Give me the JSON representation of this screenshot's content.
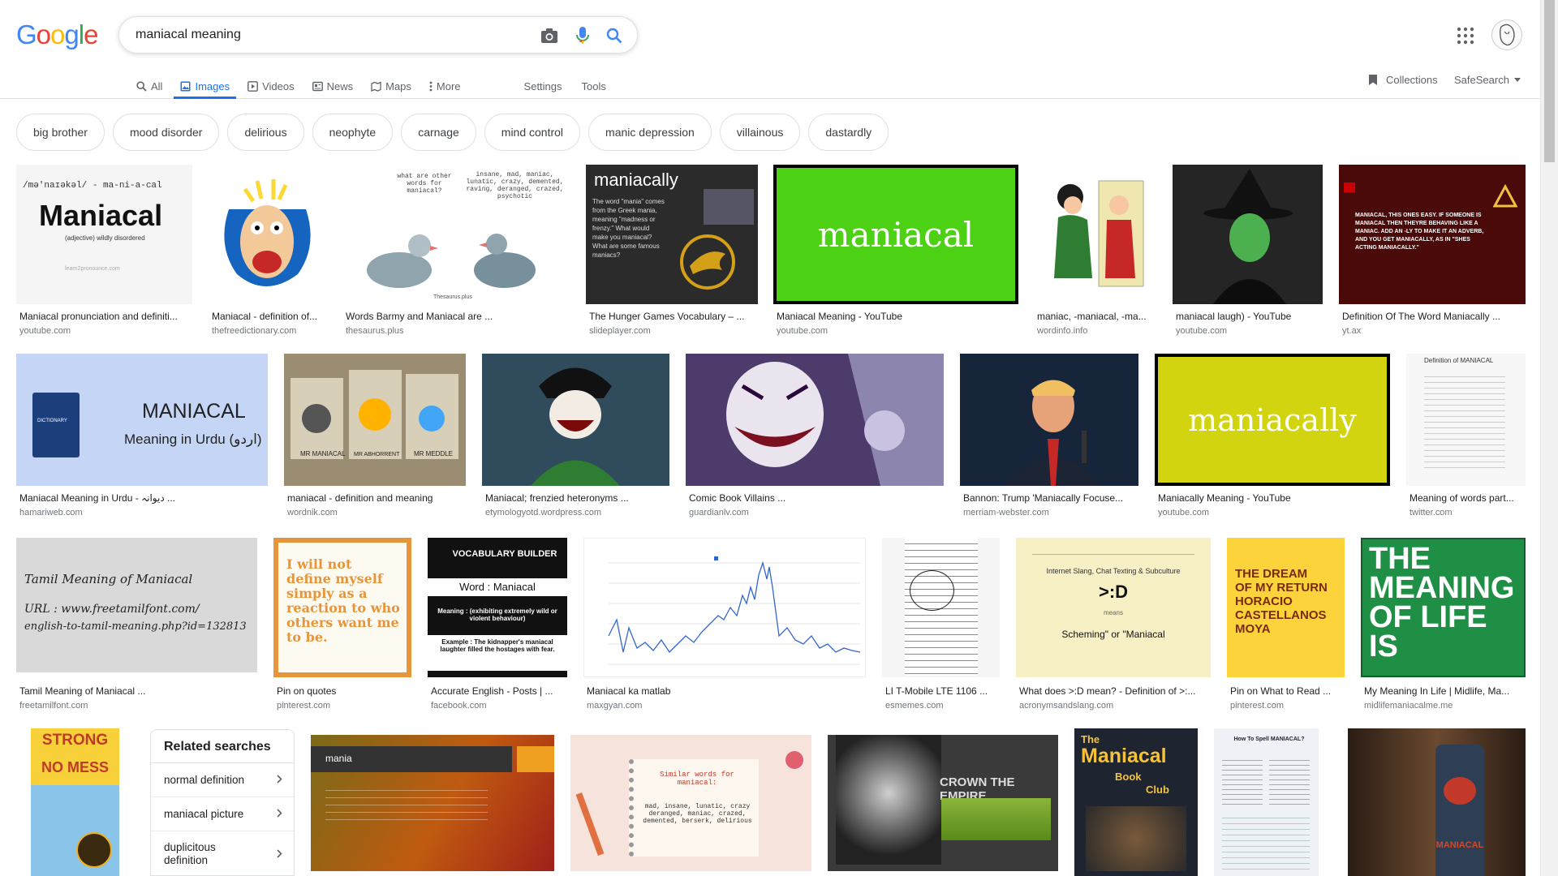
{
  "logo": {
    "letters": [
      "G",
      "o",
      "o",
      "g",
      "l",
      "e"
    ],
    "colors": [
      "#4285f4",
      "#ea4335",
      "#fbbc05",
      "#4285f4",
      "#34a853",
      "#ea4335"
    ]
  },
  "search": {
    "query": "maniacal meaning",
    "icons": [
      "camera-icon",
      "mic-icon",
      "search-icon"
    ]
  },
  "tabs": [
    {
      "label": "All",
      "icon": "search-icon"
    },
    {
      "label": "Images",
      "icon": "image-icon",
      "active": true
    },
    {
      "label": "Videos",
      "icon": "play-icon"
    },
    {
      "label": "News",
      "icon": "news-icon"
    },
    {
      "label": "Maps",
      "icon": "map-icon"
    },
    {
      "label": "More",
      "icon": "more-dots-icon"
    }
  ],
  "tools": {
    "settings": "Settings",
    "tools": "Tools",
    "collections": "Collections",
    "safesearch": "SafeSearch"
  },
  "chips": [
    "big brother",
    "mood disorder",
    "delirious",
    "neophyte",
    "carnage",
    "mind control",
    "manic depression",
    "villainous",
    "dastardly"
  ],
  "thumb_text": {
    "pronounce_phon": "/mə'naɪəkəl/ - ma-ni-a-cal",
    "pronounce_word": "Maniacal",
    "pronounce_def": "(adjective) wildly disordered",
    "pronounce_site": "learn2pronounce.com",
    "barmy_left": "what are other words for maniacal?",
    "barmy_right": "insane, mad, maniac, lunatic, crazy, demented, raving, deranged, crazed, psychotic",
    "barmy_src": "Thesaurus.plus",
    "hunger_title": "maniacally",
    "hunger_body": "The word \"mania\" comes from the Greek mania, meaning \"madness or frenzy.\" What would make you maniacal? What are some famous maniacs?",
    "yt_green": "maniacal",
    "wicked_text": "MANIACAL, THIS ONES EASY. IF SOMEONE IS MANIACAL THEN THEYRE BEHAVING LIKE A MANIAC. ADD AN -LY TO MAKE IT AN ADVERB, AND YOU GET MANIACALLY, AS IN \"SHES ACTING MANIACALLY.\"",
    "urdu_word": "MANIACAL",
    "urdu_sub": "Meaning in Urdu (اردو)",
    "dict_label": "DICTIONARY",
    "wordnik_labels": [
      "MR MANIACAL",
      "MR ABHORRENT",
      "MR MEDDLE"
    ],
    "yt_yellow": "maniacally",
    "twitter_title": "Definition of MANIACAL",
    "tamil_l1": "Tamil Meaning of Maniacal",
    "tamil_l2": "URL : www.freetamilfont.com/",
    "tamil_l3": "english-to-tamil-meaning.php?id=132813",
    "quote": "I will not define myself simply as a reaction to who others want me to be.",
    "vocab_head": "VOCABULARY BUILDER",
    "vocab_word": "Word : Maniacal",
    "vocab_meaning": "Meaning : (exhibiting extremely wild or violent behaviour)",
    "vocab_example": "Example : The kidnapper's maniacal laughter filled the hostages with fear.",
    "acro_head": "Internet Slang, Chat Texting & Subculture",
    "acro_big": ">:D",
    "acro_means": "means",
    "acro_def": "Scheming\" or \"Maniacal",
    "dream": [
      "THE DREAM",
      "OF MY RETURN",
      "HORACIO",
      "CASTELLANOS",
      "MOYA"
    ],
    "life": [
      "THE",
      "MEANING",
      "OF LIFE",
      "IS"
    ],
    "strong": [
      "STRONG",
      "NO MESS"
    ],
    "mania_title": "mania",
    "similar_title": "Similar words for maniacal:",
    "similar_body": "mad, insane, lunatic, crazy deranged, maniac, crazed, demented, berserk, delirious",
    "crown": "CROWN THE EMPIRE",
    "book": [
      "The",
      "Maniacal",
      "Book",
      "Club"
    ],
    "spell": "How To Spell MANIACAL?",
    "can": "MANIACAL"
  },
  "rows": [
    [
      {
        "title": "Maniacal pronunciation and definiti...",
        "src": "youtube.com"
      },
      {
        "title": "Maniacal - definition of...",
        "src": "thefreedictionary.com"
      },
      {
        "title": "Words Barmy and Maniacal are ...",
        "src": "thesaurus.plus"
      },
      {
        "title": "The Hunger Games Vocabulary – ...",
        "src": "slideplayer.com"
      },
      {
        "title": "Maniacal Meaning - YouTube",
        "src": "youtube.com"
      },
      {
        "title": "maniac, -maniacal, -ma...",
        "src": "wordinfo.info"
      },
      {
        "title": "maniacal laugh) - YouTube",
        "src": "youtube.com"
      },
      {
        "title": "Definition Of The Word Maniacally ...",
        "src": "yt.ax"
      }
    ],
    [
      {
        "title": "Maniacal Meaning in Urdu - دیوانہ ...",
        "src": "hamariweb.com"
      },
      {
        "title": "maniacal - definition and meaning",
        "src": "wordnik.com"
      },
      {
        "title": "Maniacal; frenzied heteronyms ...",
        "src": "etymologyotd.wordpress.com"
      },
      {
        "title": "Comic Book Villains ...",
        "src": "guardianlv.com"
      },
      {
        "title": "Bannon: Trump 'Maniacally Focuse...",
        "src": "merriam-webster.com"
      },
      {
        "title": "Maniacally Meaning - YouTube",
        "src": "youtube.com"
      },
      {
        "title": "Meaning of words part...",
        "src": "twitter.com"
      }
    ],
    [
      {
        "title": "Tamil Meaning of Maniacal ...",
        "src": "freetamilfont.com"
      },
      {
        "title": "Pin on quotes",
        "src": "pinterest.com"
      },
      {
        "title": "Accurate English - Posts | ...",
        "src": "facebook.com"
      },
      {
        "title": "Maniacal ka matlab",
        "src": "maxgyan.com"
      },
      {
        "title": "LI T-Mobile LTE 1106 ...",
        "src": "esmemes.com"
      },
      {
        "title": "What does >:D mean? - Definition of >:...",
        "src": "acronymsandslang.com"
      },
      {
        "title": "Pin on What to Read ...",
        "src": "pinterest.com"
      },
      {
        "title": "My Meaning In Life | Midlife, Ma...",
        "src": "midlifemaniacalme.me"
      }
    ]
  ],
  "related": {
    "title": "Related searches",
    "items": [
      "normal definition",
      "maniacal picture",
      "duplicitous definition"
    ]
  }
}
